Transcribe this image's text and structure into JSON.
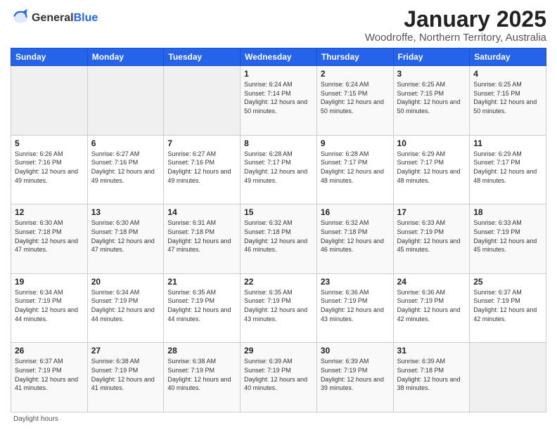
{
  "header": {
    "logo_general": "General",
    "logo_blue": "Blue",
    "month_title": "January 2025",
    "location": "Woodroffe, Northern Territory, Australia"
  },
  "days_of_week": [
    "Sunday",
    "Monday",
    "Tuesday",
    "Wednesday",
    "Thursday",
    "Friday",
    "Saturday"
  ],
  "weeks": [
    [
      {
        "day": "",
        "info": ""
      },
      {
        "day": "",
        "info": ""
      },
      {
        "day": "",
        "info": ""
      },
      {
        "day": "1",
        "info": "Sunrise: 6:24 AM\nSunset: 7:14 PM\nDaylight: 12 hours\nand 50 minutes."
      },
      {
        "day": "2",
        "info": "Sunrise: 6:24 AM\nSunset: 7:15 PM\nDaylight: 12 hours\nand 50 minutes."
      },
      {
        "day": "3",
        "info": "Sunrise: 6:25 AM\nSunset: 7:15 PM\nDaylight: 12 hours\nand 50 minutes."
      },
      {
        "day": "4",
        "info": "Sunrise: 6:25 AM\nSunset: 7:15 PM\nDaylight: 12 hours\nand 50 minutes."
      }
    ],
    [
      {
        "day": "5",
        "info": "Sunrise: 6:26 AM\nSunset: 7:16 PM\nDaylight: 12 hours\nand 49 minutes."
      },
      {
        "day": "6",
        "info": "Sunrise: 6:27 AM\nSunset: 7:16 PM\nDaylight: 12 hours\nand 49 minutes."
      },
      {
        "day": "7",
        "info": "Sunrise: 6:27 AM\nSunset: 7:16 PM\nDaylight: 12 hours\nand 49 minutes."
      },
      {
        "day": "8",
        "info": "Sunrise: 6:28 AM\nSunset: 7:17 PM\nDaylight: 12 hours\nand 49 minutes."
      },
      {
        "day": "9",
        "info": "Sunrise: 6:28 AM\nSunset: 7:17 PM\nDaylight: 12 hours\nand 48 minutes."
      },
      {
        "day": "10",
        "info": "Sunrise: 6:29 AM\nSunset: 7:17 PM\nDaylight: 12 hours\nand 48 minutes."
      },
      {
        "day": "11",
        "info": "Sunrise: 6:29 AM\nSunset: 7:17 PM\nDaylight: 12 hours\nand 48 minutes."
      }
    ],
    [
      {
        "day": "12",
        "info": "Sunrise: 6:30 AM\nSunset: 7:18 PM\nDaylight: 12 hours\nand 47 minutes."
      },
      {
        "day": "13",
        "info": "Sunrise: 6:30 AM\nSunset: 7:18 PM\nDaylight: 12 hours\nand 47 minutes."
      },
      {
        "day": "14",
        "info": "Sunrise: 6:31 AM\nSunset: 7:18 PM\nDaylight: 12 hours\nand 47 minutes."
      },
      {
        "day": "15",
        "info": "Sunrise: 6:32 AM\nSunset: 7:18 PM\nDaylight: 12 hours\nand 46 minutes."
      },
      {
        "day": "16",
        "info": "Sunrise: 6:32 AM\nSunset: 7:18 PM\nDaylight: 12 hours\nand 46 minutes."
      },
      {
        "day": "17",
        "info": "Sunrise: 6:33 AM\nSunset: 7:19 PM\nDaylight: 12 hours\nand 45 minutes."
      },
      {
        "day": "18",
        "info": "Sunrise: 6:33 AM\nSunset: 7:19 PM\nDaylight: 12 hours\nand 45 minutes."
      }
    ],
    [
      {
        "day": "19",
        "info": "Sunrise: 6:34 AM\nSunset: 7:19 PM\nDaylight: 12 hours\nand 44 minutes."
      },
      {
        "day": "20",
        "info": "Sunrise: 6:34 AM\nSunset: 7:19 PM\nDaylight: 12 hours\nand 44 minutes."
      },
      {
        "day": "21",
        "info": "Sunrise: 6:35 AM\nSunset: 7:19 PM\nDaylight: 12 hours\nand 44 minutes."
      },
      {
        "day": "22",
        "info": "Sunrise: 6:35 AM\nSunset: 7:19 PM\nDaylight: 12 hours\nand 43 minutes."
      },
      {
        "day": "23",
        "info": "Sunrise: 6:36 AM\nSunset: 7:19 PM\nDaylight: 12 hours\nand 43 minutes."
      },
      {
        "day": "24",
        "info": "Sunrise: 6:36 AM\nSunset: 7:19 PM\nDaylight: 12 hours\nand 42 minutes."
      },
      {
        "day": "25",
        "info": "Sunrise: 6:37 AM\nSunset: 7:19 PM\nDaylight: 12 hours\nand 42 minutes."
      }
    ],
    [
      {
        "day": "26",
        "info": "Sunrise: 6:37 AM\nSunset: 7:19 PM\nDaylight: 12 hours\nand 41 minutes."
      },
      {
        "day": "27",
        "info": "Sunrise: 6:38 AM\nSunset: 7:19 PM\nDaylight: 12 hours\nand 41 minutes."
      },
      {
        "day": "28",
        "info": "Sunrise: 6:38 AM\nSunset: 7:19 PM\nDaylight: 12 hours\nand 40 minutes."
      },
      {
        "day": "29",
        "info": "Sunrise: 6:39 AM\nSunset: 7:19 PM\nDaylight: 12 hours\nand 40 minutes."
      },
      {
        "day": "30",
        "info": "Sunrise: 6:39 AM\nSunset: 7:19 PM\nDaylight: 12 hours\nand 39 minutes."
      },
      {
        "day": "31",
        "info": "Sunrise: 6:39 AM\nSunset: 7:18 PM\nDaylight: 12 hours\nand 38 minutes."
      },
      {
        "day": "",
        "info": ""
      }
    ]
  ],
  "footer": {
    "note": "Daylight hours"
  }
}
